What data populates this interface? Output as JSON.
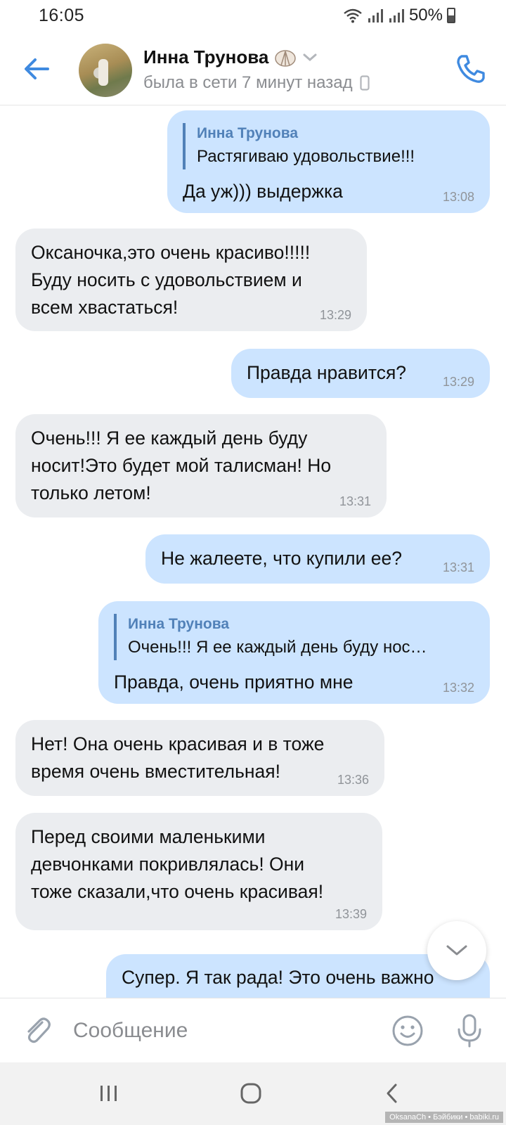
{
  "status_bar": {
    "time": "16:05",
    "battery": "50%"
  },
  "header": {
    "contact_name": "Инна Трунова",
    "status": "была в сети 7 минут назад"
  },
  "messages": [
    {
      "dir": "out",
      "reply_name": "Инна Трунова",
      "reply_text": "Растягиваю удовольствие!!!",
      "text": "Да уж))) выдержка",
      "time": "13:08"
    },
    {
      "dir": "in",
      "text": "Оксаночка,это очень красиво!!!!!\nБуду носить с удовольствием и\nвсем хвастаться!",
      "time": "13:29"
    },
    {
      "dir": "out",
      "text": "Правда нравится?",
      "time": "13:29"
    },
    {
      "dir": "in",
      "text": "Очень!!! Я ее каждый день буду\nносит!Это будет мой талисман! Но\nтолько летом!",
      "time": "13:31"
    },
    {
      "dir": "out",
      "text": "Не жалеете, что купили ее?",
      "time": "13:31"
    },
    {
      "dir": "out",
      "reply_name": "Инна Трунова",
      "reply_text": "Очень!!! Я ее каждый день буду нос…",
      "text": "Правда, очень приятно мне",
      "time": "13:32"
    },
    {
      "dir": "in",
      "text": "Нет! Она очень красивая  и в тоже\nвремя очень вместительная!",
      "time": "13:36"
    },
    {
      "dir": "in",
      "text": "Перед своими маленькими\nдевчонками покривлялась! Они\nтоже сказали,что очень красивая!",
      "time": "13:39"
    },
    {
      "dir": "out",
      "text": "Супер. Я так рада!  Это очень важно",
      "time": ""
    }
  ],
  "composer": {
    "placeholder": "Сообщение"
  },
  "watermark": "OksanaCh • Бэйбики • babiki.ru",
  "colors": {
    "accent": "#5181b8",
    "outgoing_bubble": "#cce4ff",
    "incoming_bubble": "#ebedf0"
  },
  "icons": {
    "back": "arrow-left-icon",
    "call": "phone-icon",
    "attach": "paperclip-icon",
    "emoji": "smile-icon",
    "mic": "microphone-icon",
    "scroll": "chevron-down-icon"
  }
}
